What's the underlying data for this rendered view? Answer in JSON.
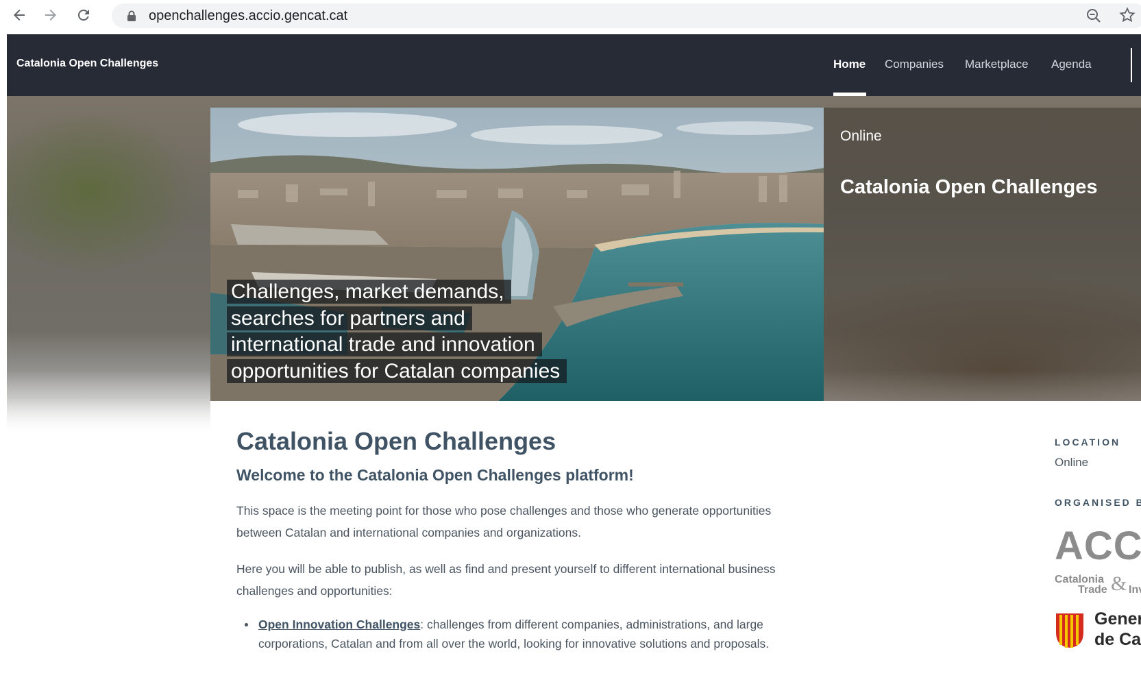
{
  "browser": {
    "url": "openchallenges.accio.gencat.cat"
  },
  "site": {
    "brand": "Catalonia Open Challenges",
    "nav": [
      {
        "label": "Home",
        "active": true
      },
      {
        "label": "Companies",
        "active": false
      },
      {
        "label": "Marketplace",
        "active": false
      },
      {
        "label": "Agenda",
        "active": false
      }
    ]
  },
  "hero": {
    "caption_lines": [
      "Challenges, market demands,",
      "searches for partners and",
      "international trade and innovation",
      "opportunities for Catalan companies"
    ],
    "location": "Online",
    "title": "Catalonia Open Challenges"
  },
  "content": {
    "title": "Catalonia Open Challenges",
    "welcome_pre": "Welcome to the ",
    "welcome_bold": "Catalonia Open Challenges",
    "welcome_post": " platform!",
    "paragraph1": "This space is the meeting point for those who pose challenges and those who generate opportunities between Catalan and international companies and organizations.",
    "paragraph2": "Here you will be able to publish, as well as find and present yourself to different international business challenges and opportunities:",
    "bullets": [
      {
        "link": "Open Innovation Challenges",
        "text": ": challenges from different companies, administrations, and large corporations, Catalan and from all over the world, looking for innovative solutions and proposals."
      }
    ]
  },
  "sidebar": {
    "location_label": "LOCATION",
    "location_value": "Online",
    "organised_label": "ORGANISED BY",
    "accio_logo_text": "ACCIÓ",
    "accio_sub1": "Catalonia",
    "accio_sub2": "Trade",
    "accio_sub3": "Investment",
    "gencat_line1": "Generalitat",
    "gencat_line2": "de Catalunya"
  },
  "colors": {
    "header_bg": "#262b36",
    "title_color": "#3f5364",
    "body_text": "#4a5560"
  }
}
